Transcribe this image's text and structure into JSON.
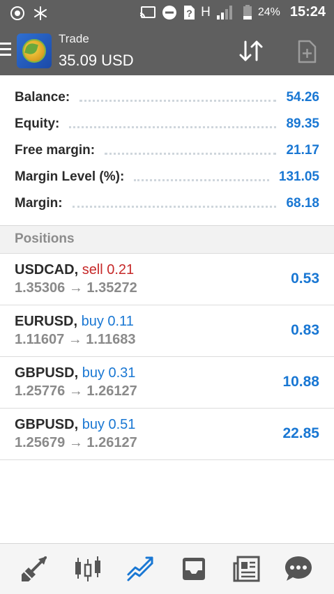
{
  "status_bar": {
    "battery_percent": "24%",
    "time": "15:24",
    "network_type": "H"
  },
  "header": {
    "title": "Trade",
    "subtitle": "35.09 USD",
    "icons": [
      "menu-icon",
      "app-logo",
      "sort-arrows-icon",
      "new-order-icon"
    ]
  },
  "summary": [
    {
      "label": "Balance:",
      "value": "54.26"
    },
    {
      "label": "Equity:",
      "value": "89.35"
    },
    {
      "label": "Free margin:",
      "value": "21.17"
    },
    {
      "label": "Margin Level (%):",
      "value": "131.05"
    },
    {
      "label": "Margin:",
      "value": "68.18"
    }
  ],
  "positions_header": "Positions",
  "positions": [
    {
      "symbol": "USDCAD",
      "sep": ",",
      "side_text": "sell 0.21",
      "side": "sell",
      "prices": "1.35306 → 1.35272",
      "profit": "0.53"
    },
    {
      "symbol": "EURUSD",
      "sep": ",",
      "side_text": "buy 0.11",
      "side": "buy",
      "prices": "1.11607 → 1.11683",
      "profit": "0.83"
    },
    {
      "symbol": "GBPUSD",
      "sep": ",",
      "side_text": "buy 0.31",
      "side": "buy",
      "prices": "1.25776 → 1.26127",
      "profit": "10.88"
    },
    {
      "symbol": "GBPUSD",
      "sep": ",",
      "side_text": "buy 0.51",
      "side": "buy",
      "prices": "1.25679 → 1.26127",
      "profit": "22.85"
    }
  ],
  "colors": {
    "header_bg": "#5f5f5f",
    "value_blue": "#1977d3",
    "sell_red": "#c62828",
    "buy_blue": "#1977d3",
    "active_tab": "#1977d3",
    "inactive_tab": "#555555"
  },
  "bottom_nav": [
    "quotes-icon",
    "chart-icon",
    "trade-icon",
    "history-icon",
    "news-icon",
    "chat-icon"
  ],
  "active_tab": "trade-icon"
}
